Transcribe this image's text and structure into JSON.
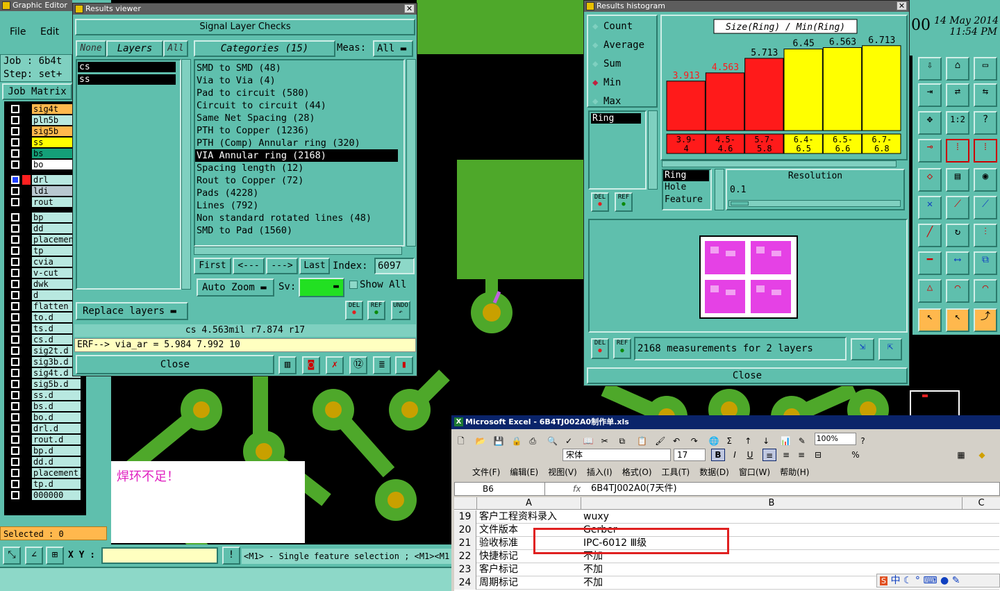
{
  "graphic_editor": {
    "title": "Graphic Editor",
    "menu": [
      "File",
      "Edit"
    ],
    "job_label": "Job : 6b4t",
    "step_label": "Step: set+",
    "job_matrix_button": "Job Matrix",
    "selected_label": "Selected : 0",
    "xy_label": "X Y :",
    "status_hint": "<M1> - Single feature selection ; <M1><M1",
    "date": "14 May 2014",
    "time": "11:54 PM",
    "partial_digits": "00",
    "annotation_note": "焊环不足！",
    "layers": [
      {
        "name": "sig4t",
        "color": "#ffb84d"
      },
      {
        "name": "pln5b",
        "color": "#b8e8e0"
      },
      {
        "name": "sig5b",
        "color": "#ffb84d"
      },
      {
        "name": "ss",
        "color": "#ffff00"
      },
      {
        "name": "bs",
        "color": "#14a078"
      },
      {
        "name": "bo",
        "color": "#ffffff"
      },
      {
        "name": "drl",
        "color": "#b8e8e0"
      },
      {
        "name": "ldi",
        "color": "#b8c8d0"
      },
      {
        "name": "rout",
        "color": "#b8e8e0"
      },
      {
        "name": "bp",
        "color": "#b8e8e0"
      },
      {
        "name": "dd",
        "color": "#b8e8e0"
      },
      {
        "name": "placemen",
        "color": "#b8e8e0"
      },
      {
        "name": "tp",
        "color": "#b8e8e0"
      },
      {
        "name": "cvia",
        "color": "#b8e8e0"
      },
      {
        "name": "v-cut",
        "color": "#b8e8e0"
      },
      {
        "name": "dwk",
        "color": "#b8e8e0"
      },
      {
        "name": "d",
        "color": "#b8e8e0"
      },
      {
        "name": "flatten",
        "color": "#b8e8e0"
      },
      {
        "name": "to.d",
        "color": "#b8e8e0"
      },
      {
        "name": "ts.d",
        "color": "#b8e8e0"
      },
      {
        "name": "cs.d",
        "color": "#b8e8e0"
      },
      {
        "name": "sig2t.d",
        "color": "#b8e8e0"
      },
      {
        "name": "sig3b.d",
        "color": "#b8e8e0"
      },
      {
        "name": "sig4t.d",
        "color": "#b8e8e0"
      },
      {
        "name": "sig5b.d",
        "color": "#b8e8e0"
      },
      {
        "name": "ss.d",
        "color": "#b8e8e0"
      },
      {
        "name": "bs.d",
        "color": "#b8e8e0"
      },
      {
        "name": "bo.d",
        "color": "#b8e8e0"
      },
      {
        "name": "drl.d",
        "color": "#b8e8e0"
      },
      {
        "name": "rout.d",
        "color": "#b8e8e0"
      },
      {
        "name": "bp.d",
        "color": "#b8e8e0"
      },
      {
        "name": "dd.d",
        "color": "#b8e8e0"
      },
      {
        "name": "placement.d",
        "color": "#b8e8e0"
      },
      {
        "name": "tp.d",
        "color": "#b8e8e0"
      },
      {
        "name": "000000",
        "color": "#b8e8e0"
      }
    ]
  },
  "results_viewer": {
    "title": "Results viewer",
    "header": "Signal Layer Checks",
    "none_label": "None",
    "layers_label": "Layers",
    "all_label": "All",
    "categories_label": "Categories (15)",
    "meas_label": "Meas:",
    "meas_value": "All",
    "layer_items": [
      "cs",
      "ss"
    ],
    "categories": [
      "SMD to SMD (48)",
      "Via to Via (4)",
      "Pad to circuit (580)",
      "Circuit to circuit (44)",
      "Same Net Spacing (28)",
      "PTH to Copper (1236)",
      "PTH (Comp) Annular ring (320)",
      "VIA Annular ring (2168)",
      "Spacing length (12)",
      "Rout to Copper (72)",
      "Pads (4228)",
      "Lines (792)",
      "Non standard rotated lines (48)",
      "SMD to Pad (1560)"
    ],
    "selected_category": "VIA Annular ring (2168)",
    "first_label": "First",
    "prev_label": "<---",
    "next_label": "--->",
    "last_label": "Last",
    "index_label": "Index:",
    "index_value": "6097",
    "auto_zoom_label": "Auto Zoom",
    "sv_label": "Sv:",
    "show_all_label": "Show All",
    "replace_layers_label": "Replace layers",
    "del_label": "DEL",
    "ref_label": "REF",
    "undo_label": "UNDO",
    "info_line": "cs 4.563mil  r7.874  r17",
    "erf_line": "ERF--> via_ar = 5.984 7.992 10",
    "close_label": "Close"
  },
  "results_histogram": {
    "title": "Results histogram",
    "stats": [
      {
        "label": "Count",
        "checked": false
      },
      {
        "label": "Average",
        "checked": false
      },
      {
        "label": "Sum",
        "checked": false
      },
      {
        "label": "Min",
        "checked": true
      },
      {
        "label": "Max",
        "checked": false
      }
    ],
    "list_items": [
      "Ring"
    ],
    "field_items": [
      "Ring",
      "Hole",
      "Feature"
    ],
    "resolution_label": "Resolution",
    "resolution_value": "0.1",
    "measurements_text": "2168 measurements for 2 layers",
    "close_label": "Close",
    "del_label": "DEL",
    "ref_label": "REF"
  },
  "chart_data": {
    "type": "bar",
    "title": "Size(Ring) / Min(Ring)",
    "categories": [
      "3.9-4",
      "4.5-4.6",
      "5.7-5.8",
      "6.4-6.5",
      "6.5-6.6",
      "6.7-6.8"
    ],
    "category_lines": [
      [
        "3.9-",
        "4"
      ],
      [
        "4.5-",
        "4.6"
      ],
      [
        "5.7-",
        "5.8"
      ],
      [
        "6.4-",
        "6.5"
      ],
      [
        "6.5-",
        "6.6"
      ],
      [
        "6.7-",
        "6.8"
      ]
    ],
    "values": [
      3.913,
      4.563,
      5.713,
      6.45,
      6.563,
      6.713
    ],
    "value_labels": [
      "3.913",
      "4.563",
      "5.713",
      "6.45",
      "6.563",
      "6.713"
    ],
    "colors": [
      "#ff1a1a",
      "#ff1a1a",
      "#ff1a1a",
      "#ffff00",
      "#ffff00",
      "#ffff00"
    ],
    "label_colors": [
      "#ff1a1a",
      "#ff1a1a",
      "#000000",
      "#000000",
      "#000000",
      "#000000"
    ],
    "ylim": [
      0,
      7.8
    ],
    "grid": false
  },
  "excel": {
    "title": "Microsoft Excel - 6B4TJ002A0制作单.xls",
    "font_name": "宋体",
    "font_size": "17",
    "zoom": "100%",
    "menus": [
      "文件(F)",
      "编辑(E)",
      "视图(V)",
      "插入(I)",
      "格式(O)",
      "工具(T)",
      "数据(D)",
      "窗口(W)",
      "帮助(H)"
    ],
    "cell_ref": "B6",
    "fx_label": "fx",
    "formula": "6B4TJ002A0(7天件)",
    "col_a": "A",
    "col_b": "B",
    "col_c": "C",
    "rows": [
      {
        "num": "19",
        "a": "客户工程资料录入",
        "b": "wuxy"
      },
      {
        "num": "20",
        "a": "文件版本",
        "b": "Gerber"
      },
      {
        "num": "21",
        "a": "验收标准",
        "b": "IPC-6012 Ⅲ级"
      },
      {
        "num": "22",
        "a": "快捷标记",
        "b": "不加"
      },
      {
        "num": "23",
        "a": "客户标记",
        "b": "不加"
      },
      {
        "num": "24",
        "a": "周期标记",
        "b": "不加"
      }
    ],
    "highlight_color": "#e02020",
    "ime_text": "中"
  },
  "colors": {
    "panel": "#5fbfad",
    "panel_dark": "#2b7a6c",
    "copper": "#4ea82a",
    "pad_drill": "#c8a000"
  }
}
